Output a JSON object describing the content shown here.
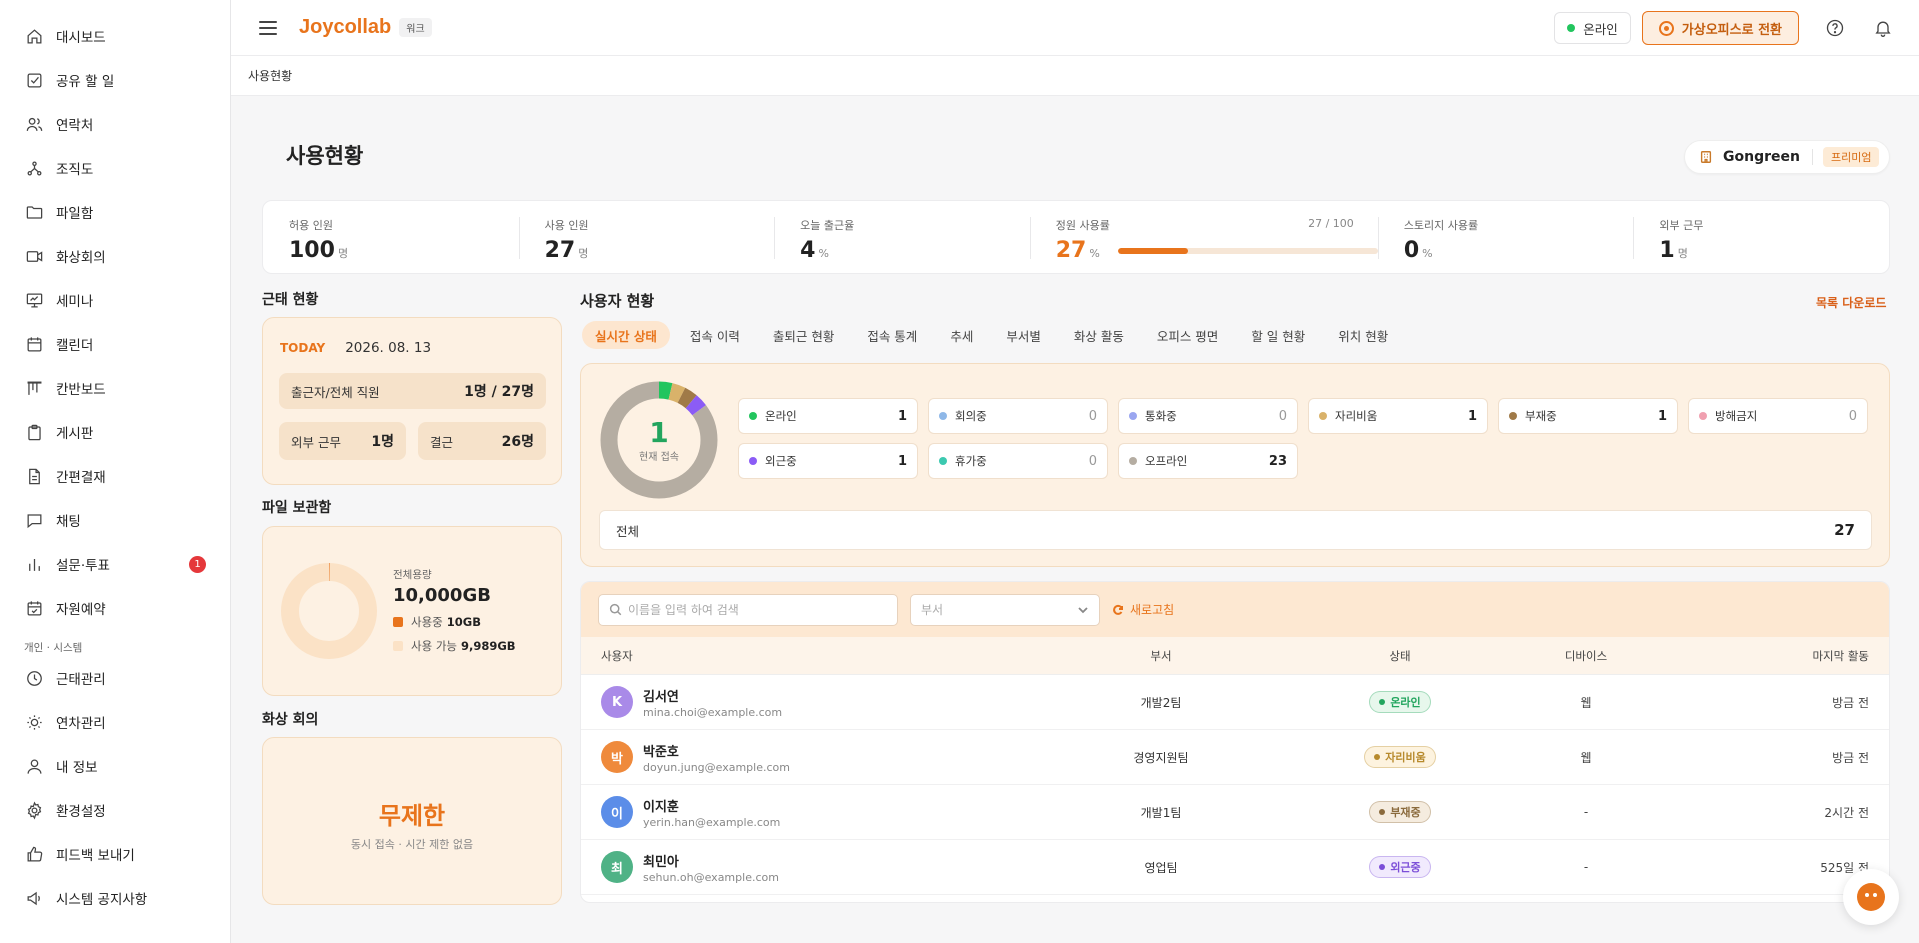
{
  "sidebar": {
    "items": [
      {
        "label": "대시보드",
        "icon": "home-icon"
      },
      {
        "label": "공유 할 일",
        "icon": "checkbox-icon"
      },
      {
        "label": "연락처",
        "icon": "users-icon"
      },
      {
        "label": "조직도",
        "icon": "org-chart-icon"
      },
      {
        "label": "파일함",
        "icon": "folder-icon"
      },
      {
        "label": "화상회의",
        "icon": "video-icon"
      },
      {
        "label": "세미나",
        "icon": "presentation-icon"
      },
      {
        "label": "캘린더",
        "icon": "calendar-icon"
      },
      {
        "label": "칸반보드",
        "icon": "kanban-icon"
      },
      {
        "label": "게시판",
        "icon": "clipboard-icon"
      },
      {
        "label": "간편결재",
        "icon": "document-icon"
      },
      {
        "label": "채팅",
        "icon": "chat-icon"
      },
      {
        "label": "설문·투표",
        "icon": "bar-chart-icon",
        "badge": "1"
      },
      {
        "label": "자원예약",
        "icon": "calendar-check-icon"
      }
    ],
    "section_label": "개인 · 시스템",
    "personal_items": [
      {
        "label": "근태관리",
        "icon": "clock-icon"
      },
      {
        "label": "연차관리",
        "icon": "sun-icon"
      },
      {
        "label": "내 정보",
        "icon": "user-icon"
      },
      {
        "label": "환경설정",
        "icon": "gear-icon"
      },
      {
        "label": "피드백 보내기",
        "icon": "thumbs-up-icon"
      },
      {
        "label": "시스템 공지사항",
        "icon": "megaphone-icon"
      }
    ]
  },
  "header": {
    "brand": "Joycollab",
    "brand_tag": "워크",
    "online_status": "온라인",
    "virtual_office_button": "가상오피스로 전환",
    "accent_color": "#e8741c"
  },
  "breadcrumb": "사용현황",
  "page": {
    "title": "사용현황",
    "org_name": "Gongreen",
    "org_plan": "프리미엄"
  },
  "stats": [
    {
      "label": "허용 인원",
      "value": "100",
      "unit": "명"
    },
    {
      "label": "사용 인원",
      "value": "27",
      "unit": "명"
    },
    {
      "label": "오늘 출근율",
      "value": "4",
      "unit": "%"
    },
    {
      "label": "정원 사용률",
      "value": "27",
      "unit": "%",
      "ratio": "27 / 100",
      "progress": 0.27
    },
    {
      "label": "스토리지 사용률",
      "value": "0",
      "unit": "%"
    },
    {
      "label": "외부 근무",
      "value": "1",
      "unit": "명"
    }
  ],
  "attendance": {
    "section_title": "근태 현황",
    "today_tag": "TODAY",
    "date": "2026. 08. 13",
    "present_label": "출근자/전체 직원",
    "present_value": "1명 / 27명",
    "remote_label": "외부 근무",
    "remote_value": "1명",
    "absent_label": "결근",
    "absent_value": "26명"
  },
  "files": {
    "section_title": "파일 보관함",
    "total_caption": "전체용량",
    "total": "10,000GB",
    "used_label": "사용중",
    "used_value": "10GB",
    "free_label": "사용 가능",
    "free_value": "9,989GB",
    "used_fraction": 0.001
  },
  "video": {
    "section_title": "화상 회의",
    "headline": "무제한",
    "subtitle": "동시 접속 · 시간 제한 없음"
  },
  "users": {
    "section_title": "사용자 현황",
    "download_link": "목록 다운로드",
    "tabs": [
      "실시간 상태",
      "접속 이력",
      "출퇴근 현황",
      "접속 통계",
      "추세",
      "부서별",
      "화상 활동",
      "오피스 평면",
      "할 일 현황",
      "위치 현황"
    ],
    "active_tab": 0,
    "current_count": "1",
    "current_label": "현재 접속",
    "status_chips": [
      {
        "label": "온라인",
        "count": "1",
        "color": "#22c55e"
      },
      {
        "label": "회의중",
        "count": "0",
        "color": "#8fb8e8"
      },
      {
        "label": "통화중",
        "count": "0",
        "color": "#9aa6f0"
      },
      {
        "label": "자리비움",
        "count": "1",
        "color": "#d9b26a"
      },
      {
        "label": "부재중",
        "count": "1",
        "color": "#a07a48"
      },
      {
        "label": "방해금지",
        "count": "0",
        "color": "#f0a0b0"
      },
      {
        "label": "외근중",
        "count": "1",
        "color": "#8b5cf6"
      },
      {
        "label": "휴가중",
        "count": "0",
        "color": "#3cc9b0"
      },
      {
        "label": "오프라인",
        "count": "23",
        "color": "#b5ada2"
      }
    ],
    "total_label": "전체",
    "total_count": "27"
  },
  "table": {
    "search_placeholder": "이름을 입력 하여 검색",
    "dept_placeholder": "부서",
    "refresh_label": "새로고침",
    "columns": [
      "사용자",
      "부서",
      "상태",
      "디바이스",
      "마지막 활동"
    ],
    "rows": [
      {
        "avatar": "K",
        "avatar_color": "#a98ae8",
        "name": "김서연",
        "email": "mina.choi@example.com",
        "dept": "개발2팀",
        "status": "온라인",
        "status_color": "#22a55e",
        "status_bg": "#e7f7ec",
        "device": "웹",
        "last": "방금 전"
      },
      {
        "avatar": "박",
        "avatar_color": "#ef8a3c",
        "name": "박준호",
        "email": "doyun.jung@example.com",
        "dept": "경영지원팀",
        "status": "자리비움",
        "status_color": "#b78a2c",
        "status_bg": "#fdf3df",
        "device": "웹",
        "last": "방금 전"
      },
      {
        "avatar": "이",
        "avatar_color": "#5b8de8",
        "name": "이지훈",
        "email": "yerin.han@example.com",
        "dept": "개발1팀",
        "status": "부재중",
        "status_color": "#8a6a3c",
        "status_bg": "#f5ecdf",
        "device": "-",
        "last": "2시간 전"
      },
      {
        "avatar": "최",
        "avatar_color": "#4fb286",
        "name": "최민아",
        "email": "sehun.oh@example.com",
        "dept": "영업팀",
        "status": "외근중",
        "status_color": "#7c4fd8",
        "status_bg": "#f1eafd",
        "device": "-",
        "last": "525일 전"
      }
    ]
  }
}
